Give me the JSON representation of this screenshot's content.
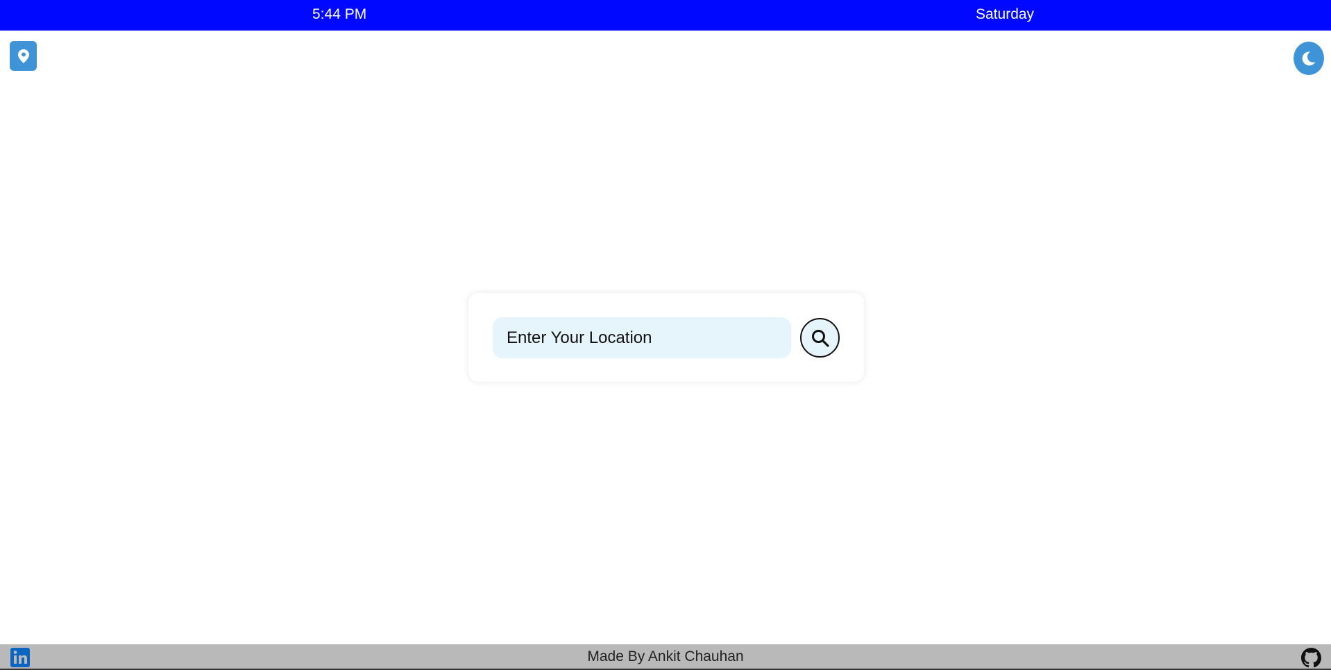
{
  "top_bar": {
    "time": "5:44 PM",
    "day": "Saturday",
    "background_color": "#0008ff"
  },
  "location_button": {
    "icon": "map-pin-icon"
  },
  "theme_toggle": {
    "icon": "moon-icon"
  },
  "search": {
    "placeholder": "Enter Your Location",
    "value": "",
    "button_icon": "search-icon",
    "input_background": "#e6f4fb"
  },
  "footer": {
    "credit": "Made By Ankit Chauhan",
    "left_icon": "linkedin-icon",
    "right_icon": "github-icon",
    "background_color": "#b9b9b9"
  },
  "accent_color": "#3e94d6"
}
